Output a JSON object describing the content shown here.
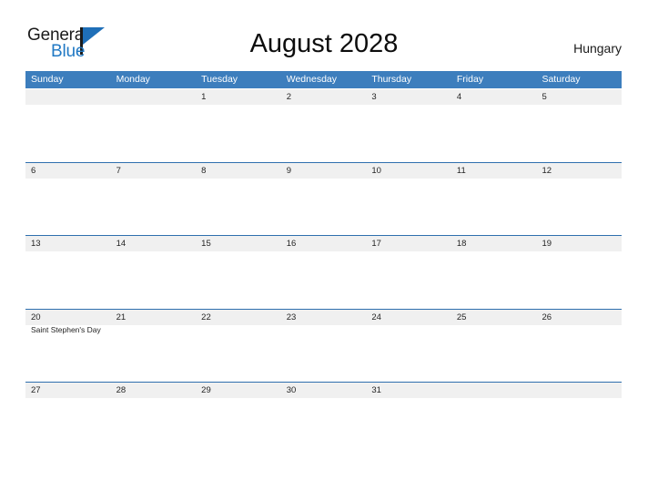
{
  "brand": {
    "name_part1": "General",
    "name_part2": "Blue",
    "logo_icon": "flag-triangle-icon",
    "accent_color": "#2179c4"
  },
  "header": {
    "title": "August 2028",
    "country": "Hungary"
  },
  "colors": {
    "header_blue": "#3d7ebd",
    "date_band_gray": "#f0f0f0",
    "row_separator": "#2f6fae",
    "text_dark": "#242424"
  },
  "calendar": {
    "month": "August",
    "year": "2028",
    "weekdays": [
      "Sunday",
      "Monday",
      "Tuesday",
      "Wednesday",
      "Thursday",
      "Friday",
      "Saturday"
    ],
    "weeks": [
      {
        "days": [
          {
            "date": "",
            "event": ""
          },
          {
            "date": "",
            "event": ""
          },
          {
            "date": "1",
            "event": ""
          },
          {
            "date": "2",
            "event": ""
          },
          {
            "date": "3",
            "event": ""
          },
          {
            "date": "4",
            "event": ""
          },
          {
            "date": "5",
            "event": ""
          }
        ]
      },
      {
        "days": [
          {
            "date": "6",
            "event": ""
          },
          {
            "date": "7",
            "event": ""
          },
          {
            "date": "8",
            "event": ""
          },
          {
            "date": "9",
            "event": ""
          },
          {
            "date": "10",
            "event": ""
          },
          {
            "date": "11",
            "event": ""
          },
          {
            "date": "12",
            "event": ""
          }
        ]
      },
      {
        "days": [
          {
            "date": "13",
            "event": ""
          },
          {
            "date": "14",
            "event": ""
          },
          {
            "date": "15",
            "event": ""
          },
          {
            "date": "16",
            "event": ""
          },
          {
            "date": "17",
            "event": ""
          },
          {
            "date": "18",
            "event": ""
          },
          {
            "date": "19",
            "event": ""
          }
        ]
      },
      {
        "days": [
          {
            "date": "20",
            "event": "Saint Stephen's Day"
          },
          {
            "date": "21",
            "event": ""
          },
          {
            "date": "22",
            "event": ""
          },
          {
            "date": "23",
            "event": ""
          },
          {
            "date": "24",
            "event": ""
          },
          {
            "date": "25",
            "event": ""
          },
          {
            "date": "26",
            "event": ""
          }
        ]
      },
      {
        "days": [
          {
            "date": "27",
            "event": ""
          },
          {
            "date": "28",
            "event": ""
          },
          {
            "date": "29",
            "event": ""
          },
          {
            "date": "30",
            "event": ""
          },
          {
            "date": "31",
            "event": ""
          },
          {
            "date": "",
            "event": ""
          },
          {
            "date": "",
            "event": ""
          }
        ]
      }
    ]
  }
}
